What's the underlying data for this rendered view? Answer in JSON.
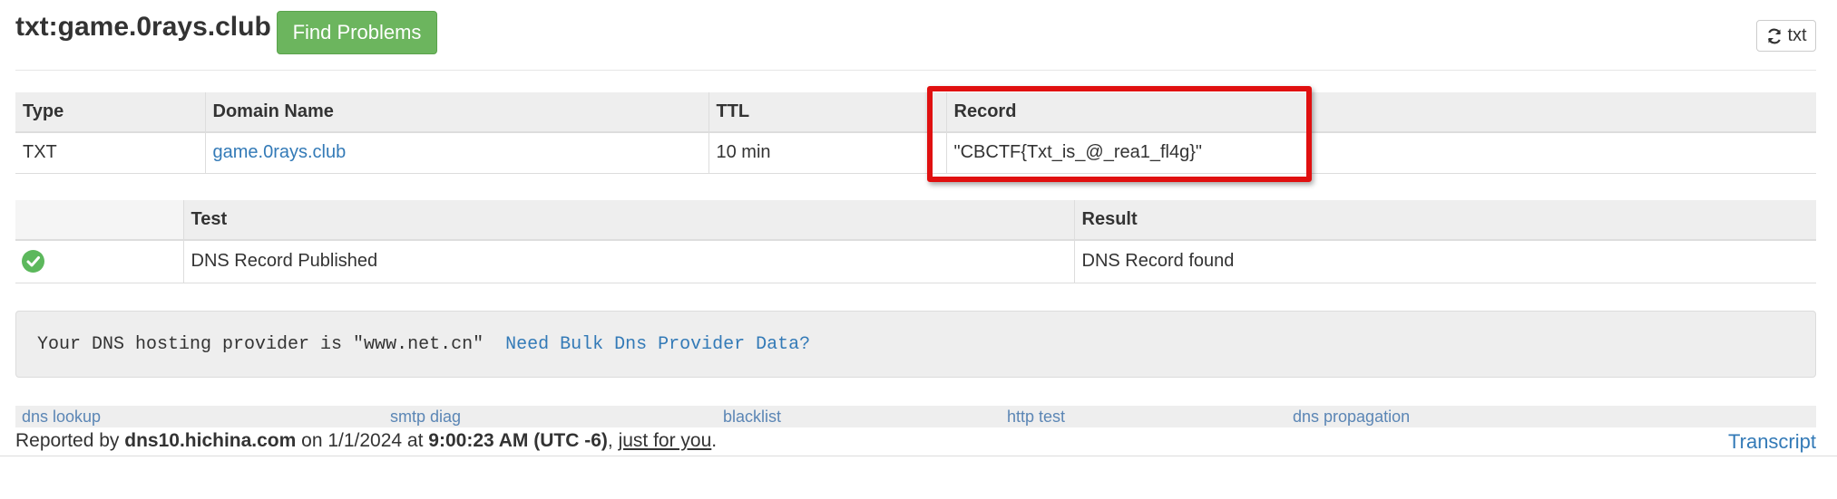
{
  "header": {
    "title": "txt:game.0rays.club",
    "find_button": "Find Problems",
    "refresh_label": "txt"
  },
  "records_table": {
    "columns": [
      "Type",
      "Domain Name",
      "TTL",
      "Record"
    ],
    "rows": [
      {
        "type": "TXT",
        "domain": "game.0rays.club",
        "ttl": "10 min",
        "record": "\"CBCTF{Txt_is_@_rea1_fl4g}\""
      }
    ]
  },
  "tests_table": {
    "columns": [
      "",
      "Test",
      "Result"
    ],
    "rows": [
      {
        "status_icon": "check-circle-icon",
        "test": "DNS Record Published",
        "result": "DNS Record found"
      }
    ]
  },
  "provider": {
    "text": "Your DNS hosting provider is \"www.net.cn\"",
    "link": "Need Bulk Dns Provider Data?"
  },
  "links": [
    "dns lookup",
    "smtp diag",
    "blacklist",
    "http test",
    "dns propagation"
  ],
  "footer": {
    "reported_by_prefix": "Reported by",
    "server": "dns10.hichina.com",
    "on_text": "on 1/1/2024 at",
    "time": "9:00:23 AM (UTC -6)",
    "comma": ",",
    "just_for_you": "just for you",
    "period": ".",
    "transcript": "Transcript"
  },
  "colors": {
    "find_button": "#6cb55e",
    "link": "#337ab7",
    "highlight": "#e01010",
    "success": "#5cb85c"
  }
}
